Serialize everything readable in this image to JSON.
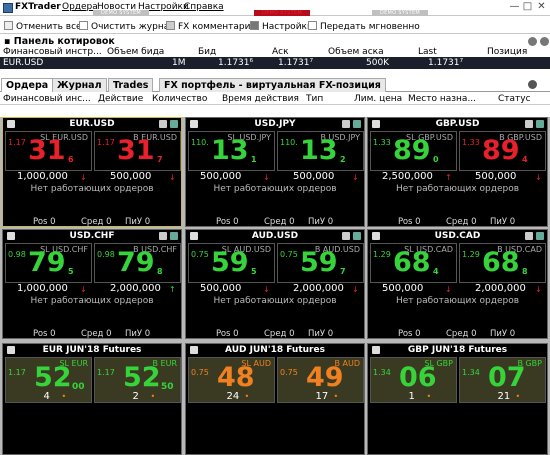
{
  "window": {
    "app_name": "FXTrader",
    "menu": [
      "Ордера",
      "Новости",
      "Настройки",
      "Справка"
    ],
    "demo_label": "DEMO SYSTEM",
    "controls": [
      "—",
      "□",
      "✕"
    ]
  },
  "toolbar": {
    "cancel_all": "Отменить все",
    "clear_log": "Очистить журнал",
    "fx_comments": "FX комментарии",
    "settings": "Настройки",
    "transmit_now": "Передать мгновенно"
  },
  "quotes_panel": {
    "title": "Панель котировок",
    "columns": [
      "Финансовый инстр...",
      "Объем бида",
      "Бид",
      "Аск",
      "Объем аска",
      "Last",
      "Позиция"
    ],
    "row": {
      "instrument": "EUR.USD",
      "bid_size": "1M",
      "bid": "1.1731⁶",
      "ask": "1.1731⁷",
      "ask_size": "500K",
      "last": "1.1731⁷",
      "position": ""
    }
  },
  "tabs": [
    "Ордера",
    "Журнал",
    "Trades",
    "FX портфель - виртуальная FX-позиция"
  ],
  "orders_columns": [
    "Финансовый инс...",
    "Действие",
    "Количество",
    "Время действия",
    "Тип",
    "Лим. цена",
    "Место назна...",
    "Статус"
  ],
  "tiles": [
    {
      "title": "EUR.USD",
      "sell_label": "SL EUR.USD",
      "buy_label": "B EUR.USD",
      "sell_pre": "1.17",
      "sell_big": "31",
      "sell_sub": "6",
      "buy_pre": "1.17",
      "buy_big": "31",
      "buy_sub": "7",
      "sell_size": "1,000,000",
      "buy_size": "500,000",
      "sell_arrow": "↓",
      "buy_arrow": "↓",
      "sell_color": "#e8202a",
      "buy_color": "#e8202a",
      "no_orders": "Нет работающих ордеров",
      "pos": "Pos  0",
      "avg": "Сред  0",
      "pnl": "ПиУ  0",
      "selected": true
    },
    {
      "title": "USD.JPY",
      "sell_label": "SL USD.JPY",
      "buy_label": "B USD.JPY",
      "sell_pre": "110.",
      "sell_big": "13",
      "sell_sub": "1",
      "buy_pre": "110.",
      "buy_big": "13",
      "buy_sub": "2",
      "sell_size": "500,000",
      "buy_size": "500,000",
      "sell_arrow": "↓",
      "buy_arrow": "↓",
      "sell_color": "#36d43a",
      "buy_color": "#36d43a",
      "no_orders": "Нет работающих ордеров",
      "pos": "Pos  0",
      "avg": "Сред  0",
      "pnl": "ПиУ  0",
      "selected": false
    },
    {
      "title": "GBP.USD",
      "sell_label": "SL GBP.USD",
      "buy_label": "B GBP.USD",
      "sell_pre": "1.33",
      "sell_big": "89",
      "sell_sub": "0",
      "buy_pre": "1.33",
      "buy_big": "89",
      "buy_sub": "4",
      "sell_size": "2,500,000",
      "buy_size": "500,000",
      "sell_arrow": "↑",
      "buy_arrow": "↓",
      "sell_color": "#36d43a",
      "buy_color": "#e8202a",
      "no_orders": "Нет работающих ордеров",
      "pos": "Pos  0",
      "avg": "Сред  0",
      "pnl": "ПиУ  0",
      "selected": false
    },
    {
      "title": "USD.CHF",
      "sell_label": "SL USD.CHF",
      "buy_label": "B USD.CHF",
      "sell_pre": "0.98",
      "sell_big": "79",
      "sell_sub": "5",
      "buy_pre": "0.98",
      "buy_big": "79",
      "buy_sub": "8",
      "sell_size": "1,000,000",
      "buy_size": "2,000,000",
      "sell_arrow": "↓",
      "buy_arrow": "↑",
      "sell_color": "#36d43a",
      "buy_color": "#36d43a",
      "no_orders": "Нет работающих ордеров",
      "pos": "Pos  0",
      "avg": "Сред  0",
      "pnl": "ПиУ  0",
      "selected": false
    },
    {
      "title": "AUD.USD",
      "sell_label": "SL AUD.USD",
      "buy_label": "B AUD.USD",
      "sell_pre": "0.75",
      "sell_big": "59",
      "sell_sub": "5",
      "buy_pre": "0.75",
      "buy_big": "59",
      "buy_sub": "7",
      "sell_size": "500,000",
      "buy_size": "2,000,000",
      "sell_arrow": "↓",
      "buy_arrow": "↓",
      "sell_color": "#36d43a",
      "buy_color": "#36d43a",
      "no_orders": "Нет работающих ордеров",
      "pos": "Pos  0",
      "avg": "Сред  0",
      "pnl": "ПиУ  0",
      "selected": false
    },
    {
      "title": "USD.CAD",
      "sell_label": "SL USD.CAD",
      "buy_label": "B USD.CAD",
      "sell_pre": "1.29",
      "sell_big": "68",
      "sell_sub": "4",
      "buy_pre": "1.29",
      "buy_big": "68",
      "buy_sub": "8",
      "sell_size": "500,000",
      "buy_size": "2,000,000",
      "sell_arrow": "↓",
      "buy_arrow": "↓",
      "sell_color": "#36d43a",
      "buy_color": "#36d43a",
      "no_orders": "Нет работающих ордеров",
      "pos": "Pos  0",
      "avg": "Сред  0",
      "pnl": "ПиУ  0",
      "selected": false
    }
  ],
  "futures": [
    {
      "title": "EUR JUN'18 Futures",
      "sell_label": "SL EUR",
      "buy_label": "B EUR",
      "sell_pre": "1.17",
      "sell_big": "52",
      "sell_sub": "00",
      "buy_pre": "1.17",
      "buy_big": "52",
      "buy_sub": "50",
      "sell_count": "4",
      "buy_count": "2",
      "sell_color": "#36d43a",
      "buy_color": "#36d43a"
    },
    {
      "title": "AUD JUN'18 Futures",
      "sell_label": "SL AUD",
      "buy_label": "B AUD",
      "sell_pre": "0.75",
      "sell_big": "48",
      "sell_sub": "",
      "buy_pre": "0.75",
      "buy_big": "49",
      "buy_sub": "",
      "sell_count": "24",
      "buy_count": "17",
      "sell_color": "#f08020",
      "buy_color": "#f08020"
    },
    {
      "title": "GBP JUN'18 Futures",
      "sell_label": "SL GBP",
      "buy_label": "B GBP",
      "sell_pre": "1.34",
      "sell_big": "06",
      "sell_sub": "",
      "buy_pre": "1.34",
      "buy_big": "07",
      "buy_sub": "",
      "sell_count": "1",
      "buy_count": "21",
      "sell_color": "#36d43a",
      "buy_color": "#36d43a"
    }
  ]
}
